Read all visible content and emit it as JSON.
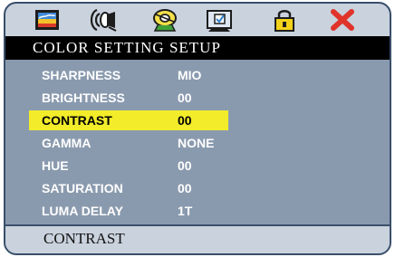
{
  "toolbar": {
    "icons": [
      {
        "name": "picture-settings-icon"
      },
      {
        "name": "audio-settings-icon"
      },
      {
        "name": "disc-settings-icon"
      },
      {
        "name": "checkbox-settings-icon"
      },
      {
        "name": "lock-icon"
      },
      {
        "name": "exit-icon"
      }
    ]
  },
  "title": "COLOR SETTING SETUP",
  "menu": {
    "items": [
      {
        "label": "SHARPNESS",
        "value": "MIO"
      },
      {
        "label": "BRIGHTNESS",
        "value": "00"
      },
      {
        "label": "CONTRAST",
        "value": "00"
      },
      {
        "label": "GAMMA",
        "value": "NONE"
      },
      {
        "label": "HUE",
        "value": "00"
      },
      {
        "label": "SATURATION",
        "value": "00"
      },
      {
        "label": "LUMA DELAY",
        "value": "1T"
      }
    ],
    "selected": "CONTRAST"
  },
  "status": "CONTRAST",
  "colors": {
    "background": "#8a9aae",
    "toolbar": "#c9d2dd",
    "title_bar": "#000000",
    "highlight": "#f2ec2a",
    "text": "#ffffff",
    "exit_icon": "#e0342b"
  }
}
